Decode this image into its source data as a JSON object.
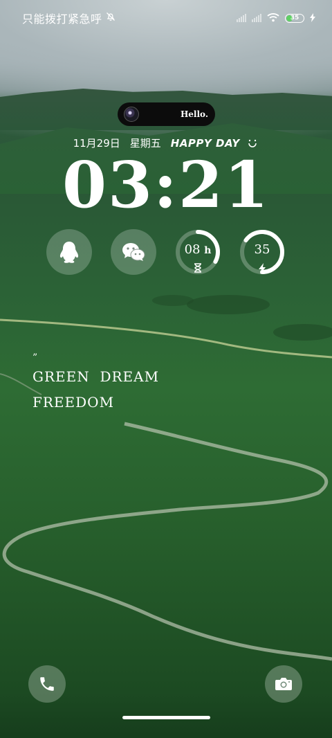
{
  "status_bar": {
    "carrier_text": "只能拨打紧急呼",
    "icons": [
      "mute-bell-icon",
      "signal-off-icon",
      "signal-off-icon",
      "wifi-icon",
      "battery-icon",
      "charging-icon"
    ],
    "battery_level": "35",
    "battery_fill_fraction": 0.35,
    "battery_color": "#5fd064"
  },
  "island": {
    "text": "Hello."
  },
  "date": {
    "date_text": "11月29日",
    "weekday": "星期五",
    "greeting": "HAPPY DAY",
    "smile": "◡̈"
  },
  "clock": {
    "time": "03:21"
  },
  "widgets": {
    "qq_icon": "qq-penguin-icon",
    "wechat_icon": "wechat-icon",
    "timer_value": "08",
    "timer_unit": "h",
    "timer_icon": "hourglass-icon",
    "timer_fraction": 0.33,
    "battery_value": "35",
    "battery_icon": "charging-bolt-icon",
    "battery_fraction": 0.35
  },
  "quote": {
    "mark": "”",
    "line1": "GREEN  DREAM",
    "line2": "FREEDOM"
  },
  "shortcuts": {
    "left_icon": "phone-icon",
    "right_icon": "camera-icon"
  }
}
